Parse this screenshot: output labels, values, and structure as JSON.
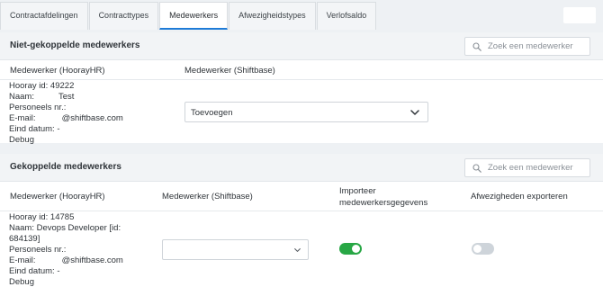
{
  "tabs": [
    {
      "label": "Contractafdelingen",
      "active": false
    },
    {
      "label": "Contracttypes",
      "active": false
    },
    {
      "label": "Medewerkers",
      "active": true
    },
    {
      "label": "Afwezigheidstypes",
      "active": false
    },
    {
      "label": "Verlofsaldo",
      "active": false
    }
  ],
  "unlinked": {
    "title": "Niet-gekoppelde medewerkers",
    "search_placeholder": "Zoek een medewerker",
    "col_hooray": "Medewerker (HoorayHR)",
    "col_shiftbase": "Medewerker (Shiftbase)",
    "employee": {
      "hooray_id": "Hooray id: 49222",
      "name_label": "Naam:",
      "name_value": "Test",
      "personnel": "Personeels nr.:",
      "email_label": "E-mail:",
      "email_value": "@shiftbase.com",
      "end_date": "Eind datum: -",
      "extra": "Debug"
    },
    "select_value": "Toevoegen"
  },
  "linked": {
    "title": "Gekoppelde medewerkers",
    "search_placeholder": "Zoek een medewerker",
    "col_hooray": "Medewerker (HoorayHR)",
    "col_shiftbase": "Medewerker (Shiftbase)",
    "col_import_1": "Importeer",
    "col_import_2": "medewerkersgegevens",
    "col_absence": "Afwezigheden exporteren",
    "employee": {
      "hooray_id": "Hooray id: 14785",
      "name_1": "Naam: Devops Developer [id:",
      "name_2": "684139]",
      "personnel": "Personeels nr.:",
      "email_label": "E-mail:",
      "email_value": "@shiftbase.com",
      "end_date": "Eind datum: -",
      "extra": "Debug"
    },
    "select_value": "",
    "import_enabled": true,
    "absence_enabled": false
  },
  "colors": {
    "toggle_on": "#28a745",
    "toggle_off": "#ced4da",
    "accent": "#1e7bd7"
  }
}
